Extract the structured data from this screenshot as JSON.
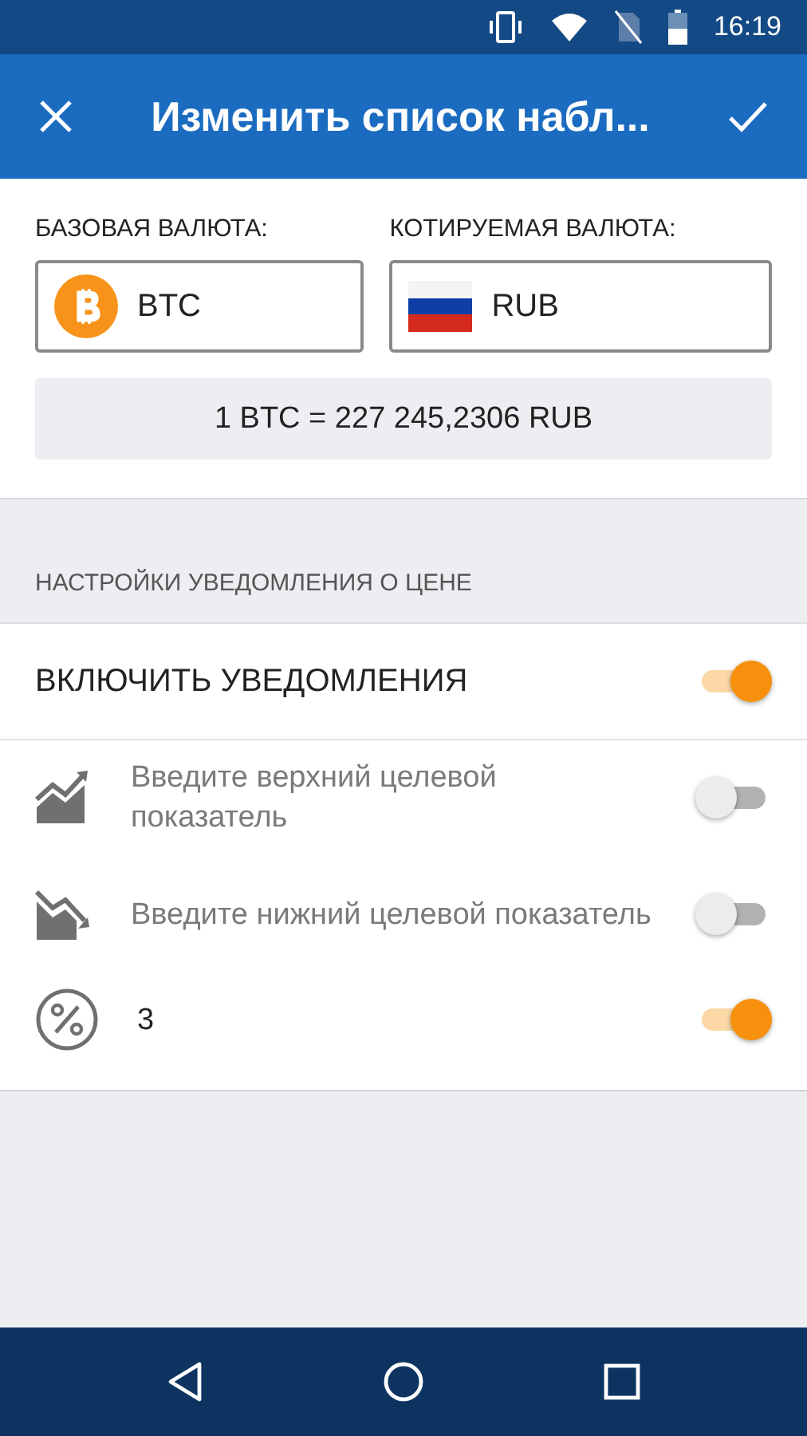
{
  "status_bar": {
    "time": "16:19"
  },
  "app_bar": {
    "title": "Изменить список набл..."
  },
  "currencies": [
    {
      "kind": "bitcoin",
      "label": "БАЗОВАЯ ВАЛЮТА:",
      "value": "BTC"
    },
    {
      "kind": "flag",
      "label": "КОТИРУЕМАЯ ВАЛЮТА:",
      "value": "RUB"
    }
  ],
  "rate": "1 BTC = 227 245,2306 RUB",
  "section_header": "НАСТРОЙКИ УВЕДОМЛЕНИЯ О ЦЕНЕ",
  "notifications": {
    "label": "ВКЛЮЧИТЬ УВЕДОМЛЕНИЯ",
    "on": true
  },
  "alerts": [
    {
      "kind": "upper",
      "placeholder": "Введите верхний целевой показатель",
      "on": false
    },
    {
      "kind": "lower",
      "placeholder": "Введите нижний целевой показатель",
      "on": false
    },
    {
      "kind": "percent",
      "value": "3",
      "on": true
    }
  ]
}
